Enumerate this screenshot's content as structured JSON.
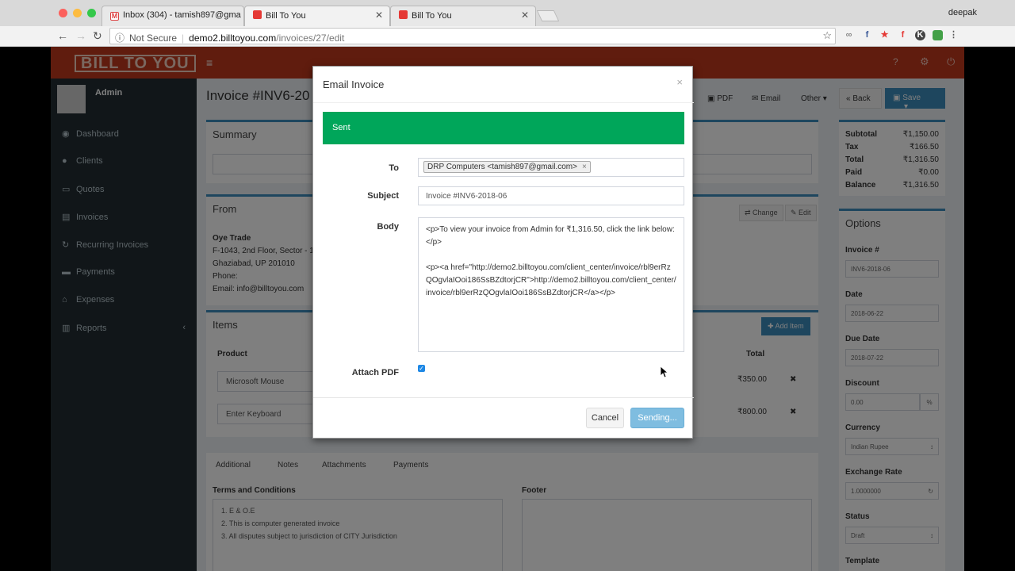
{
  "browser": {
    "tabs": [
      {
        "label": "Inbox (304) - tamish897@gma",
        "active": false
      },
      {
        "label": "Bill To You",
        "active": true
      },
      {
        "label": "Bill To You",
        "active": false
      }
    ],
    "profile_name": "deepak",
    "security_label": "Not Secure",
    "url_host": "demo2.billtoyou.com",
    "url_path": "/invoices/27/edit"
  },
  "app": {
    "logo": "BILL TO YOU",
    "user": "Admin",
    "menu": [
      "Dashboard",
      "Clients",
      "Quotes",
      "Invoices",
      "Recurring Invoices",
      "Payments",
      "Expenses",
      "Reports"
    ],
    "page_title": "Invoice #INV6-20",
    "sections": {
      "summary": "Summary",
      "from": "From",
      "items": "Items",
      "options": "Options"
    },
    "from": {
      "name": "Oye Trade",
      "address1": "F-1043, 2nd Floor, Sector - 1",
      "address2": "Ghaziabad, UP 201010",
      "phone": "Phone:",
      "email": "Email: info@billtoyou.com"
    },
    "toolbar": {
      "pdf": "PDF",
      "email": "Email",
      "other": "Other",
      "back": "Back",
      "save": "Save"
    },
    "totals": [
      {
        "label": "Subtotal",
        "value": "₹1,150.00"
      },
      {
        "label": "Tax",
        "value": "₹166.50"
      },
      {
        "label": "Total",
        "value": "₹1,316.50"
      },
      {
        "label": "Paid",
        "value": "₹0.00"
      },
      {
        "label": "Balance",
        "value": "₹1,316.50"
      }
    ],
    "items_header": {
      "product": "Product",
      "total": "Total",
      "add": "Add Item"
    },
    "items": [
      {
        "product": "Microsoft Mouse",
        "total": "₹350.00"
      },
      {
        "product": "Enter Keyboard",
        "total": "₹800.00"
      }
    ],
    "from_actions": {
      "change": "Change",
      "edit": "Edit"
    },
    "tabs": [
      "Additional",
      "Notes",
      "Attachments",
      "Payments"
    ],
    "terms_label": "Terms and Conditions",
    "terms": [
      "1. E & O.E",
      "2. This is computer generated invoice",
      "3. All disputes subject to jurisdiction of CITY Jurisdiction"
    ],
    "footer_label": "Footer",
    "options": {
      "invoice_label": "Invoice #",
      "invoice_value": "INV6-2018-06",
      "date_label": "Date",
      "date_value": "2018-06-22",
      "due_label": "Due Date",
      "due_value": "2018-07-22",
      "discount_label": "Discount",
      "discount_value": "0.00",
      "discount_unit": "%",
      "currency_label": "Currency",
      "currency_value": "Indian Rupee",
      "rate_label": "Exchange Rate",
      "rate_value": "1.0000000",
      "status_label": "Status",
      "status_value": "Draft",
      "template_label": "Template"
    }
  },
  "modal": {
    "title": "Email Invoice",
    "alert": "Sent",
    "to_label": "To",
    "to_tag": "DRP Computers <tamish897@gmail.com>",
    "subject_label": "Subject",
    "subject_value": "Invoice #INV6-2018-06",
    "body_label": "Body",
    "body_line1": "<p>To view your invoice from Admin for ₹1,316.50, click the link below:</p>",
    "body_line2": "<p><a href=\"http://demo2.billtoyou.com/client_center/invoice/rbl9erRzQOgvlaIOoi186SsBZdtorjCR\">http://demo2.billtoyou.com/client_center/invoice/rbl9erRzQOgvlaIOoi186SsBZdtorjCR</a></p>",
    "attach_label": "Attach PDF",
    "cancel": "Cancel",
    "send": "Sending..."
  },
  "colors": {
    "accent": "#3c8dbc",
    "brand": "#c0391d",
    "success": "#00a65a",
    "sidebar": "#222d32"
  }
}
